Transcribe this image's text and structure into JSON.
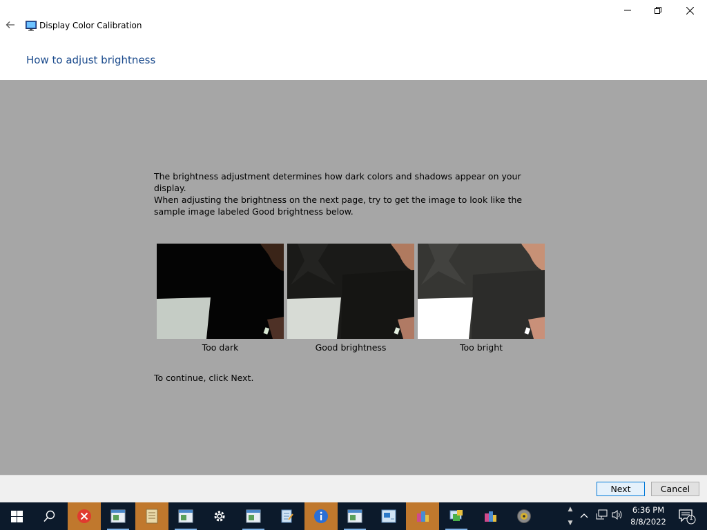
{
  "window": {
    "app_title": "Display Color Calibration",
    "page_title": "How to adjust brightness"
  },
  "content": {
    "para1": "The brightness adjustment determines how dark colors and shadows appear on your display.",
    "para2": "When adjusting the brightness on the next page, try to get the image to look like the sample image labeled Good brightness below.",
    "samples": [
      {
        "label": "Too dark"
      },
      {
        "label": "Good brightness"
      },
      {
        "label": "Too bright"
      }
    ],
    "continue_text": "To continue, click Next."
  },
  "footer": {
    "next_label": "Next",
    "cancel_label": "Cancel"
  },
  "taskbar": {
    "time": "6:36 PM",
    "date": "8/8/2022",
    "notification_count": "1"
  },
  "colors": {
    "title_blue": "#1a4a8c",
    "content_bg": "#a6a6a6",
    "taskbar_bg": "#0c1a2b",
    "active_app": "#c0782d"
  }
}
